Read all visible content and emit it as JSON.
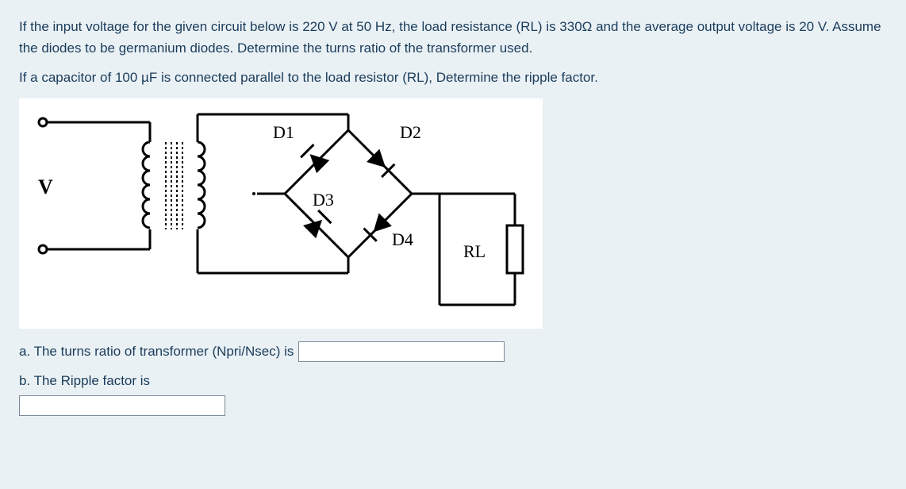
{
  "question": {
    "paragraph1": "If the input voltage for the given circuit below  is 220 V at 50 Hz, the load resistance (RL) is 330Ω and the average output voltage is 20 V. Assume the diodes to be germanium diodes. Determine the turns ratio of the transformer used.",
    "paragraph2": "If a capacitor of 100 µF is connected parallel to the load resistor (RL), Determine the ripple factor."
  },
  "circuit": {
    "V": "V",
    "D1": "D1",
    "D2": "D2",
    "D3": "D3",
    "D4": "D4",
    "RL": "RL"
  },
  "answers": {
    "a_label": "a. The turns ratio of transformer (Npri/Nsec) is",
    "a_value": "",
    "b_label": "b. The Ripple factor is",
    "b_value": ""
  }
}
